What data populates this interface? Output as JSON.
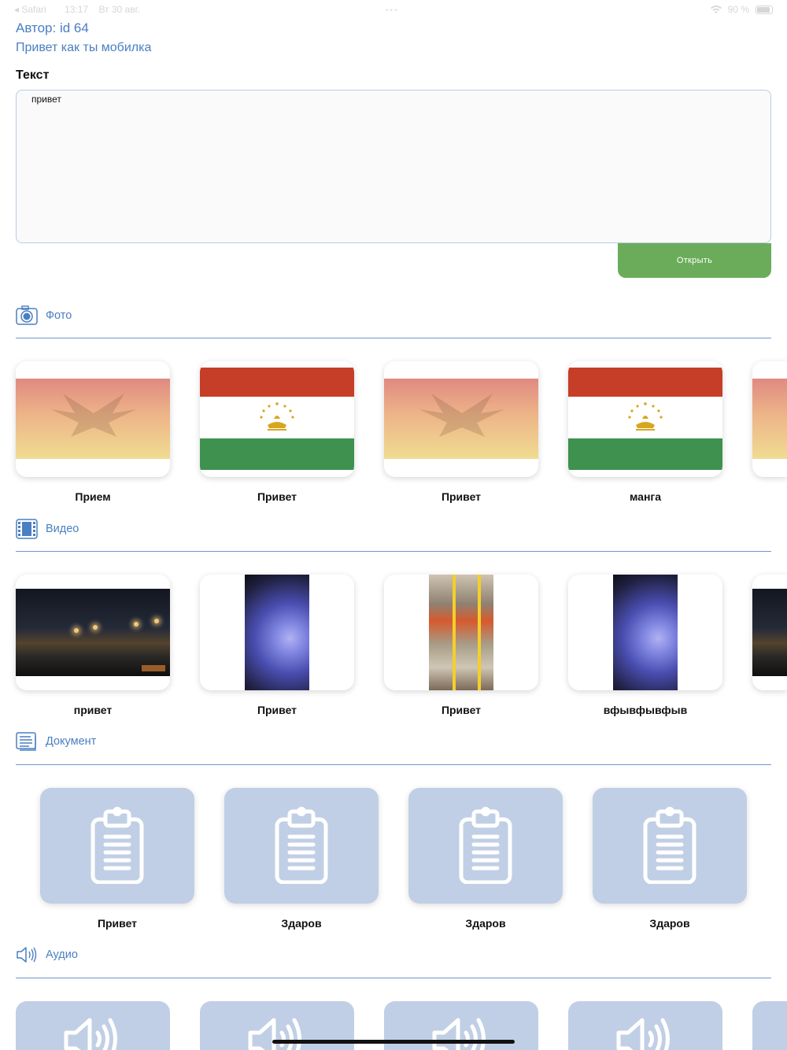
{
  "status_bar": {
    "app": "Safari",
    "time": "13:17",
    "date": "Вт 30 авг.",
    "battery": "90 %"
  },
  "header": {
    "author": "Автор: id 64",
    "subtitle": "Привет как ты мобилка"
  },
  "text_section": {
    "label": "Текст",
    "value": "привет",
    "open_button": "Открыть"
  },
  "sections": {
    "photo": {
      "title": "Фото",
      "items": [
        {
          "label": "Прием",
          "image": "eagle-emblem"
        },
        {
          "label": "Привет",
          "image": "tajikistan-flag"
        },
        {
          "label": "Привет",
          "image": "eagle-emblem"
        },
        {
          "label": "манга",
          "image": "tajikistan-flag"
        }
      ]
    },
    "video": {
      "title": "Видео",
      "items": [
        {
          "label": "привет",
          "thumb": "night-street"
        },
        {
          "label": "Привет",
          "thumb": "blue-lens"
        },
        {
          "label": "Привет",
          "thumb": "bus-interior"
        },
        {
          "label": "вфывфывфыв",
          "thumb": "blue-lens"
        }
      ]
    },
    "document": {
      "title": "Документ",
      "items": [
        {
          "label": "Привет",
          "icon": "clipboard-icon"
        },
        {
          "label": "Здаров",
          "icon": "clipboard-icon"
        },
        {
          "label": "Здаров",
          "icon": "clipboard-icon"
        },
        {
          "label": "Здаров",
          "icon": "clipboard-icon"
        }
      ]
    },
    "audio": {
      "title": "Аудио",
      "icon": "speaker-icon"
    }
  },
  "colors": {
    "accent": "#4a7fc2",
    "button": "#6aac5a",
    "doc_card": "#c0cfe5"
  }
}
